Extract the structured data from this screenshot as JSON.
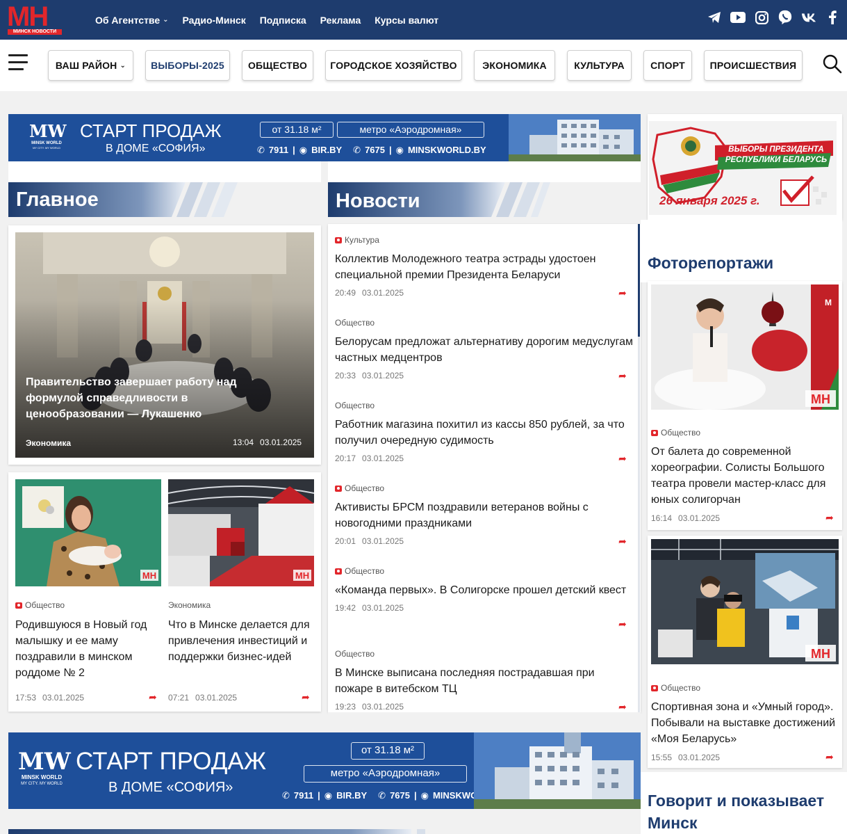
{
  "header": {
    "logo_text": "МН",
    "logo_sub": "МИНСК НОВОСТИ",
    "nav": [
      {
        "label": "Об Агентстве"
      },
      {
        "label": "Радио-Минск"
      },
      {
        "label": "Подписка"
      },
      {
        "label": "Реклама"
      },
      {
        "label": "Курсы валют"
      }
    ],
    "social": [
      "telegram-icon",
      "youtube-icon",
      "instagram-icon",
      "viber-icon",
      "vk-icon",
      "facebook-icon"
    ]
  },
  "sections": [
    {
      "label": "ВАШ РАЙОН"
    },
    {
      "label": "ВЫБОРЫ-2025"
    },
    {
      "label": "ОБЩЕСТВО"
    },
    {
      "label": "ГОРОДСКОЕ ХОЗЯЙСТВО"
    },
    {
      "label": "ЭКОНОМИКА"
    },
    {
      "label": "КУЛЬТУРА"
    },
    {
      "label": "СПОРТ"
    },
    {
      "label": "ПРОИСШЕСТВИЯ"
    }
  ],
  "banner_top": {
    "logo": "MW",
    "logo_name": "MINSK WORLD",
    "logo_tag": "MY CITY. MY WORLD",
    "title": "СТАРТ ПРОДАЖ",
    "subtitle": "В ДОМЕ «СОФИЯ»",
    "price": "от 31.18 м²",
    "metro": "метро «Аэродромная»",
    "phone1": "7911",
    "site1": "BIR.BY",
    "phone2": "7675",
    "site2": "MINSKWORLD.BY"
  },
  "elections": {
    "title_line1": "ВЫБОРЫ ПРЕЗИДЕНТА",
    "title_line2": "РЕСПУБЛИКИ БЕЛАРУСЬ",
    "date": "26 января 2025 г."
  },
  "main": {
    "heading": "Главное",
    "lead": {
      "title": "Правительство завершает работу над формулой справедливости в ценообразовании — Лукашенко",
      "category": "Экономика",
      "time": "13:04",
      "date": "03.01.2025"
    },
    "cards": [
      {
        "category": "Общество",
        "title": "Родившуюся в Новый год малышку и ее маму поздравили в минском роддоме № 2",
        "time": "17:53",
        "date": "03.01.2025",
        "photo": true
      },
      {
        "category": "Экономика",
        "title": "Что в Минске делается для привлечения инвестиций и поддержки бизнес-идей",
        "time": "07:21",
        "date": "03.01.2025",
        "photo": false
      }
    ]
  },
  "news": {
    "heading": "Новости",
    "items": [
      {
        "category": "Культура",
        "photo": true,
        "title": "Коллектив Молодежного театра эстрады удостоен специальной премии Президента Беларуси",
        "time": "20:49",
        "date": "03.01.2025"
      },
      {
        "category": "Общество",
        "photo": false,
        "title": "Белорусам предложат альтернативу дорогим медуслугам частных медцентров",
        "time": "20:33",
        "date": "03.01.2025"
      },
      {
        "category": "Общество",
        "photo": false,
        "title": "Работник магазина похитил из кассы 850 рублей, за что получил очередную судимость",
        "time": "20:17",
        "date": "03.01.2025"
      },
      {
        "category": "Общество",
        "photo": true,
        "title": "Активисты БРСМ поздравили ветеранов войны с новогодними праздниками",
        "time": "20:01",
        "date": "03.01.2025"
      },
      {
        "category": "Общество",
        "photo": true,
        "title": "«Команда первых». В Солигорске прошел детский квест",
        "time": "19:42",
        "date": "03.01.2025"
      },
      {
        "category": "Общество",
        "photo": false,
        "title": "В Минске выписана последняя пострадавшая при пожаре в витебском ТЦ",
        "time": "19:23",
        "date": "03.01.2025"
      }
    ]
  },
  "photoreports": {
    "heading": "Фоторепортажи",
    "items": [
      {
        "category": "Общество",
        "title": "От балета до современной хореографии. Солисты Большого театра провели мастер-класс для юных солигорчан",
        "time": "16:14",
        "date": "03.01.2025"
      },
      {
        "category": "Общество",
        "title": "Спортивная зона и «Умный город». Побывали на выставке достижений «Моя Беларусь»",
        "time": "15:55",
        "date": "03.01.2025"
      }
    ]
  },
  "speaks": {
    "heading": "Говорит и показывает Минск"
  },
  "colors": {
    "topbar": "#1e3c6e",
    "brand_red": "#e2262b",
    "heading_blue": "#1e3c6e",
    "banner_blue": "#1e4f9a"
  }
}
